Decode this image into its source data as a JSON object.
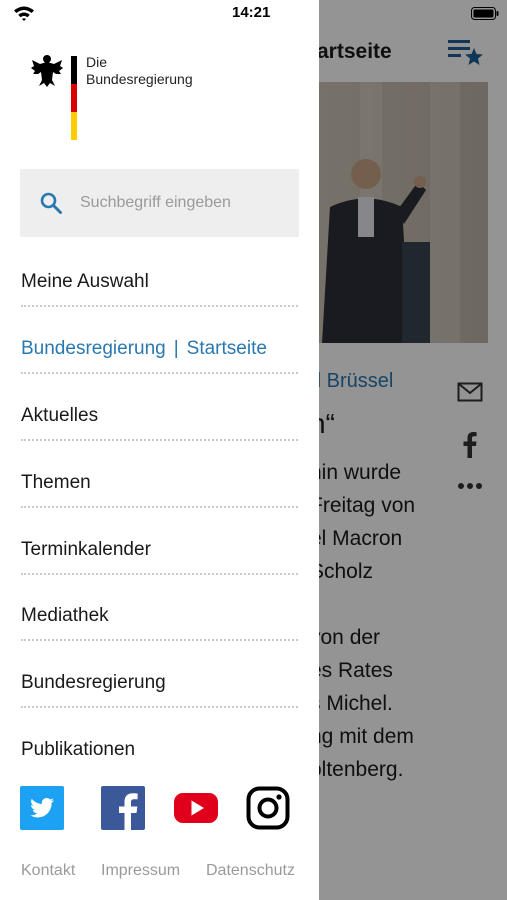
{
  "status_bar": {
    "time": "14:21"
  },
  "main": {
    "title": "tartseite",
    "kicker": "d Brüssel",
    "headline": "n“",
    "body_lines": [
      "hin wurde",
      "Freitag von",
      "el Macron",
      "Scholz",
      "",
      "von der",
      "es Rates",
      "s Michel.",
      "ng mit dem",
      "oltenberg."
    ]
  },
  "drawer": {
    "logo": {
      "text": "Die\nBundesregierung"
    },
    "search": {
      "placeholder": "Suchbegriff eingeben",
      "value": ""
    },
    "menu": [
      {
        "label": "Meine Auswahl"
      },
      {
        "label_a": "Bundesregierung",
        "separator": "|",
        "label_b": "Startseite"
      },
      {
        "label": "Aktuelles"
      },
      {
        "label": "Themen"
      },
      {
        "label": "Terminkalender"
      },
      {
        "label": "Mediathek"
      },
      {
        "label": "Bundesregierung"
      },
      {
        "label": "Publikationen"
      }
    ],
    "social": [
      "twitter-icon",
      "facebook-icon",
      "youtube-icon",
      "instagram-icon"
    ],
    "footer": {
      "contact": "Kontakt",
      "imprint": "Impressum",
      "privacy": "Datenschutz"
    }
  },
  "colors": {
    "accent": "#2a78b0",
    "overlay": "rgba(0,0,0,0.42)",
    "search_bg": "#eeeeee",
    "divider": "#c9c9c9"
  }
}
